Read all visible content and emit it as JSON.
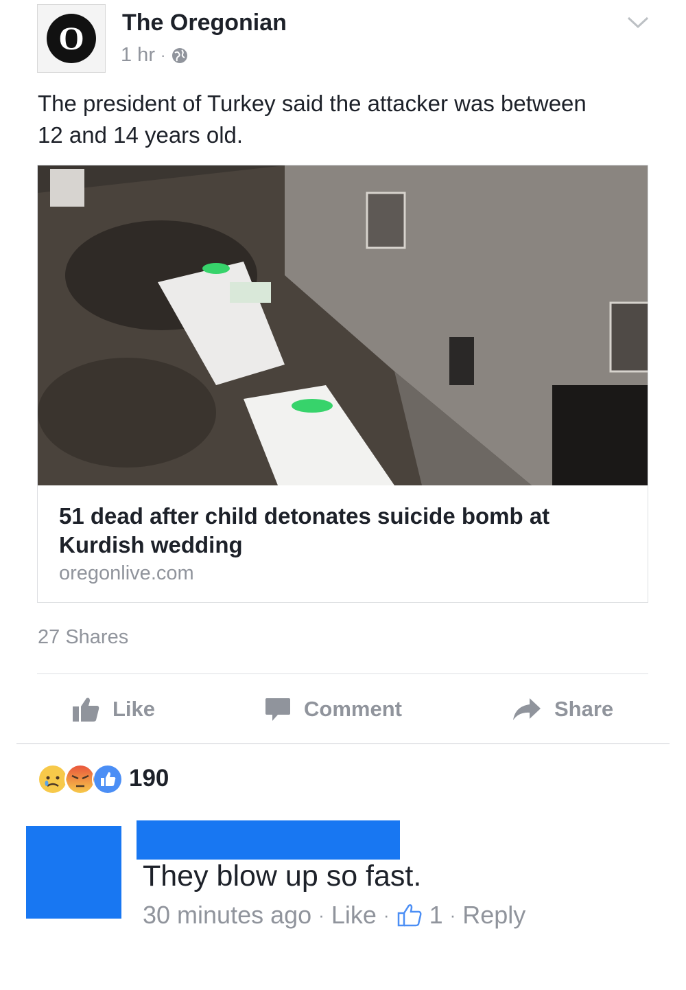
{
  "post": {
    "page_name": "The Oregonian",
    "avatar_letter": "O",
    "time": "1 hr",
    "privacy_icon": "globe-icon",
    "text": "The president of Turkey said the attacker was between 12 and 14 years old."
  },
  "link": {
    "title": "51 dead after child detonates suicide bomb at Kurdish wedding",
    "domain": "oregonlive.com"
  },
  "stats": {
    "shares": "27 Shares"
  },
  "actions": {
    "like": "Like",
    "comment": "Comment",
    "share": "Share"
  },
  "reactions": {
    "icons": [
      "sad-icon",
      "angry-icon",
      "like-icon"
    ],
    "count": "190"
  },
  "comment": {
    "text": "They blow up so fast.",
    "time": "30 minutes ago",
    "like_label": "Like",
    "like_count": "1",
    "reply_label": "Reply"
  },
  "colors": {
    "facebook_blue": "#1877f2",
    "meta_gray": "#90949c",
    "text": "#1d2129"
  }
}
